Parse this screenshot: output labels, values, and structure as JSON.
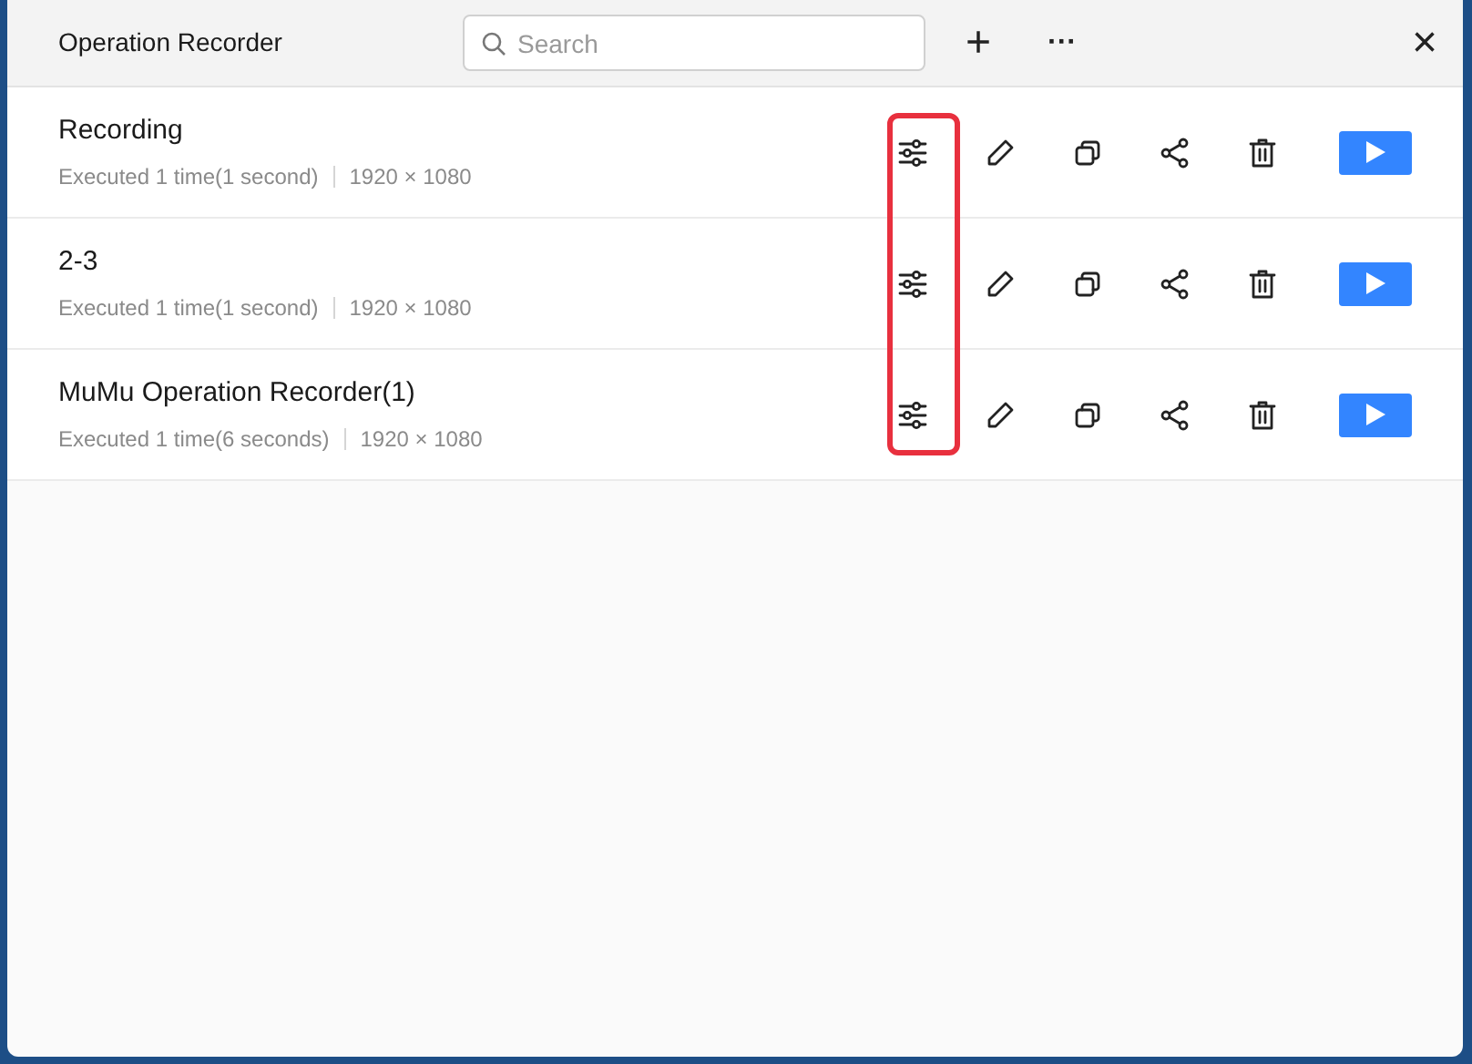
{
  "window": {
    "title": "Operation Recorder"
  },
  "search": {
    "placeholder": "Search"
  },
  "toolbar": {
    "add": "+",
    "more": "···",
    "close": "×"
  },
  "recordings": [
    {
      "name": "Recording",
      "executed": "Executed 1 time(1 second)",
      "resolution": "1920 × 1080"
    },
    {
      "name": "2-3",
      "executed": "Executed 1 time(1 second)",
      "resolution": "1920 × 1080"
    },
    {
      "name": "MuMu Operation Recorder(1)",
      "executed": "Executed 1 time(6 seconds)",
      "resolution": "1920 × 1080"
    }
  ]
}
